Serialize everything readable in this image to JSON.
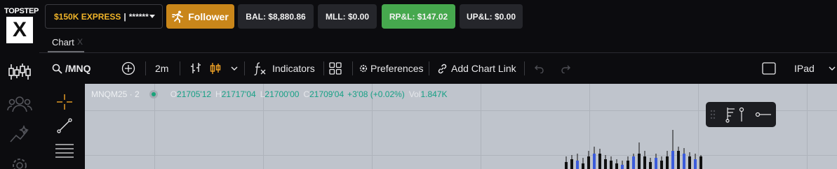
{
  "brand": {
    "line1": "TOPSTEP",
    "line2": "X"
  },
  "rail": {
    "icons": [
      "candlestick-chart-icon",
      "users-icon",
      "sparkle-trend-icon",
      "gear-icon"
    ]
  },
  "account": {
    "name": "$150K EXPRESS",
    "separator": "|",
    "masked": "******"
  },
  "follower": {
    "label": "Follower"
  },
  "stats": {
    "bal": "BAL: $8,880.86",
    "mll": "MLL: $0.00",
    "rpl": "RP&L: $147.02",
    "upl": "UP&L: $0.00"
  },
  "colors": {
    "accent": "#c9861a",
    "account_name": "#f0b429",
    "positive": "#46a84e",
    "legend_value": "#16a085",
    "bull_candle": "#3b5bdb",
    "bear_candle": "#111111"
  },
  "tabs": [
    {
      "label": "Chart",
      "close": "X"
    }
  ],
  "toolbar": {
    "symbol": "/MNQ",
    "interval": "2m",
    "indicators": "Indicators",
    "preferences": "Preferences",
    "add_chart_link": "Add Chart Link",
    "layout": "IPad"
  },
  "legend": {
    "symbol": "MNQM25 · 2",
    "o_label": "O",
    "o": "21705'12",
    "h_label": "H",
    "h": "21717'04",
    "l_label": "L",
    "l": "21700'00",
    "c_label": "C",
    "c": "21709'04",
    "change": "+3'08 (+0.02%)",
    "vol_label": "Vol",
    "vol": "1.847K"
  }
}
